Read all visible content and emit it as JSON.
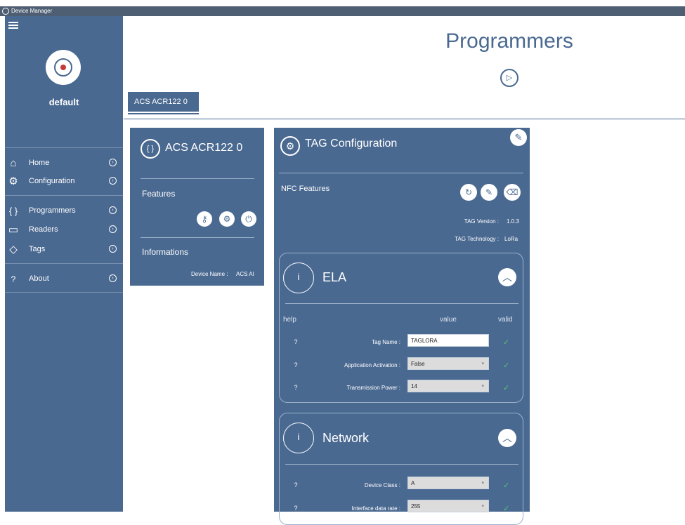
{
  "window": {
    "title": "Device Manager"
  },
  "sidebar": {
    "profile_name": "default",
    "items": [
      {
        "icon": "home-icon",
        "glyph": "⌂",
        "label": "Home"
      },
      {
        "icon": "gear-icon",
        "glyph": "⚙",
        "label": "Configuration"
      },
      {
        "icon": "braces-icon",
        "glyph": "{ }",
        "label": "Programmers"
      },
      {
        "icon": "reader-icon",
        "glyph": "▭",
        "label": "Readers"
      },
      {
        "icon": "tag-icon",
        "glyph": "◇",
        "label": "Tags"
      },
      {
        "icon": "question-icon",
        "glyph": "?",
        "label": "About"
      }
    ]
  },
  "header": {
    "title": "Programmers"
  },
  "tabs": [
    {
      "label": "ACS ACR122 0"
    }
  ],
  "device_card": {
    "title": "ACS ACR122 0",
    "features_label": "Features",
    "informations_label": "Informations",
    "device_name_label": "Device Name :",
    "device_name_value": "ACS AI"
  },
  "tag_config": {
    "title": "TAG Configuration",
    "nfc_features_label": "NFC Features",
    "tag_version_label": "TAG Version :",
    "tag_version_value": "1.0.3",
    "tag_technology_label": "TAG Technology :",
    "tag_technology_value": "LoRa",
    "sections": [
      {
        "title": "ELA",
        "info_glyph": "i",
        "headers": {
          "help": "help",
          "value": "value",
          "valid": "valid"
        },
        "rows": [
          {
            "help": "?",
            "label": "Tag Name :",
            "value": "TAGLORA",
            "type": "text"
          },
          {
            "help": "?",
            "label": "Application Activation :",
            "value": "False",
            "type": "select"
          },
          {
            "help": "?",
            "label": "Transmission Power :",
            "value": "14",
            "type": "select"
          }
        ]
      },
      {
        "title": "Network",
        "info_glyph": "i",
        "rows": [
          {
            "help": "?",
            "label": "Device Class :",
            "value": "A",
            "type": "select"
          },
          {
            "help": "?",
            "label": "Interface data rate :",
            "value": "255",
            "type": "select"
          }
        ]
      }
    ]
  },
  "colors": {
    "panel": "#4a6991",
    "accent_text": "#4a6991",
    "valid": "#58c46c"
  }
}
